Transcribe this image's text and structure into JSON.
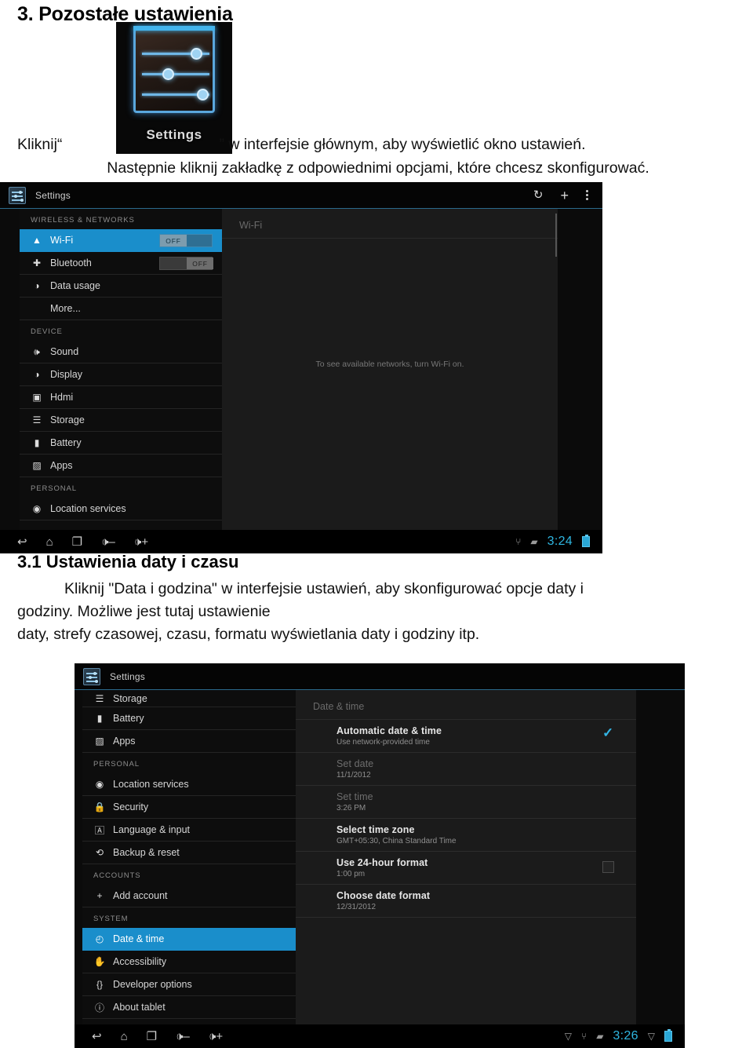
{
  "document": {
    "heading1": "3. Pozostałe ustawienia",
    "heading2": "3.1 Ustawienia daty i czasu",
    "app_icon_label": "Settings",
    "para1_before": "Kliknij“",
    "para1_after": "” w interfejsie głównym, aby wyświetlić okno ustawień.",
    "para2": "Następnie kliknij zakładkę z odpowiednimi opcjami, które chcesz skonfigurować.",
    "para3_line1": "Kliknij \"Data i godzina\" w interfejsie ustawień, aby skonfigurować opcje daty i",
    "para3_line2": "godziny. Możliwe jest tutaj ustawienie",
    "para3_line3": "daty, strefy czasowej, czasu, formatu wyświetlania daty i godziny itp."
  },
  "colors": {
    "accent_blue": "#1a8ecb",
    "clock_cyan": "#2fb6e0",
    "check_blue": "#33b5e5"
  },
  "screenshot1": {
    "actionbar": {
      "title": "Settings",
      "icons": [
        "refresh-icon",
        "plus-icon",
        "overflow-menu-icon"
      ]
    },
    "sections": [
      {
        "header": "WIRELESS & NETWORKS",
        "items": [
          {
            "label": "Wi-Fi",
            "icon": "wifi-icon",
            "selected": true,
            "toggle": "OFF"
          },
          {
            "label": "Bluetooth",
            "icon": "bluetooth-icon",
            "selected": false,
            "toggle": "OFF"
          },
          {
            "label": "Data usage",
            "icon": "data-usage-icon",
            "selected": false
          },
          {
            "label": "More...",
            "icon": "",
            "selected": false
          }
        ]
      },
      {
        "header": "DEVICE",
        "items": [
          {
            "label": "Sound",
            "icon": "sound-icon",
            "selected": false
          },
          {
            "label": "Display",
            "icon": "display-icon",
            "selected": false
          },
          {
            "label": "Hdmi",
            "icon": "hdmi-icon",
            "selected": false
          },
          {
            "label": "Storage",
            "icon": "storage-icon",
            "selected": false
          },
          {
            "label": "Battery",
            "icon": "battery-icon",
            "selected": false
          },
          {
            "label": "Apps",
            "icon": "apps-icon",
            "selected": false
          }
        ]
      },
      {
        "header": "PERSONAL",
        "items": [
          {
            "label": "Location services",
            "icon": "location-icon",
            "selected": false
          }
        ]
      }
    ],
    "detail": {
      "title": "Wi-Fi",
      "empty_text": "To see available networks, turn Wi-Fi on."
    },
    "navbar": {
      "buttons": [
        "back-icon",
        "home-icon",
        "recents-icon",
        "volume-down-icon",
        "volume-up-icon"
      ],
      "status_icons": [
        "usb-icon",
        "sdcard-icon"
      ],
      "clock": "3:24"
    }
  },
  "screenshot2": {
    "actionbar": {
      "title": "Settings"
    },
    "sections": [
      {
        "header": "",
        "items": [
          {
            "label": "Storage",
            "icon": "storage-icon",
            "selected": false
          },
          {
            "label": "Battery",
            "icon": "battery-icon",
            "selected": false
          },
          {
            "label": "Apps",
            "icon": "apps-icon",
            "selected": false
          }
        ]
      },
      {
        "header": "PERSONAL",
        "items": [
          {
            "label": "Location services",
            "icon": "location-icon",
            "selected": false
          },
          {
            "label": "Security",
            "icon": "lock-icon",
            "selected": false
          },
          {
            "label": "Language & input",
            "icon": "language-icon",
            "selected": false
          },
          {
            "label": "Backup & reset",
            "icon": "backup-reset-icon",
            "selected": false
          }
        ]
      },
      {
        "header": "ACCOUNTS",
        "items": [
          {
            "label": "Add account",
            "icon": "plus-icon",
            "selected": false
          }
        ]
      },
      {
        "header": "SYSTEM",
        "items": [
          {
            "label": "Date & time",
            "icon": "clock-icon",
            "selected": true
          },
          {
            "label": "Accessibility",
            "icon": "accessibility-hand-icon",
            "selected": false
          },
          {
            "label": "Developer options",
            "icon": "braces-icon",
            "selected": false
          },
          {
            "label": "About tablet",
            "icon": "info-icon",
            "selected": false
          }
        ]
      }
    ],
    "detail": {
      "title": "Date & time",
      "rows": [
        {
          "title": "Automatic date & time",
          "subtitle": "Use network-provided time",
          "dim": false,
          "checkbox": "on"
        },
        {
          "title": "Set date",
          "subtitle": "11/1/2012",
          "dim": true,
          "checkbox": "none"
        },
        {
          "title": "Set time",
          "subtitle": "3:26 PM",
          "dim": true,
          "checkbox": "none"
        },
        {
          "title": "Select time zone",
          "subtitle": "GMT+05:30, China Standard Time",
          "dim": false,
          "checkbox": "none"
        },
        {
          "title": "Use 24-hour format",
          "subtitle": "1:00 pm",
          "dim": false,
          "checkbox": "off"
        },
        {
          "title": "Choose date format",
          "subtitle": "12/31/2012",
          "dim": false,
          "checkbox": "none"
        }
      ]
    },
    "navbar": {
      "buttons": [
        "back-icon",
        "home-icon",
        "recents-icon",
        "volume-down-icon",
        "volume-up-icon"
      ],
      "status_icons": [
        "wifi-icon",
        "usb-icon",
        "sdcard-icon"
      ],
      "clock": "3:26"
    }
  }
}
